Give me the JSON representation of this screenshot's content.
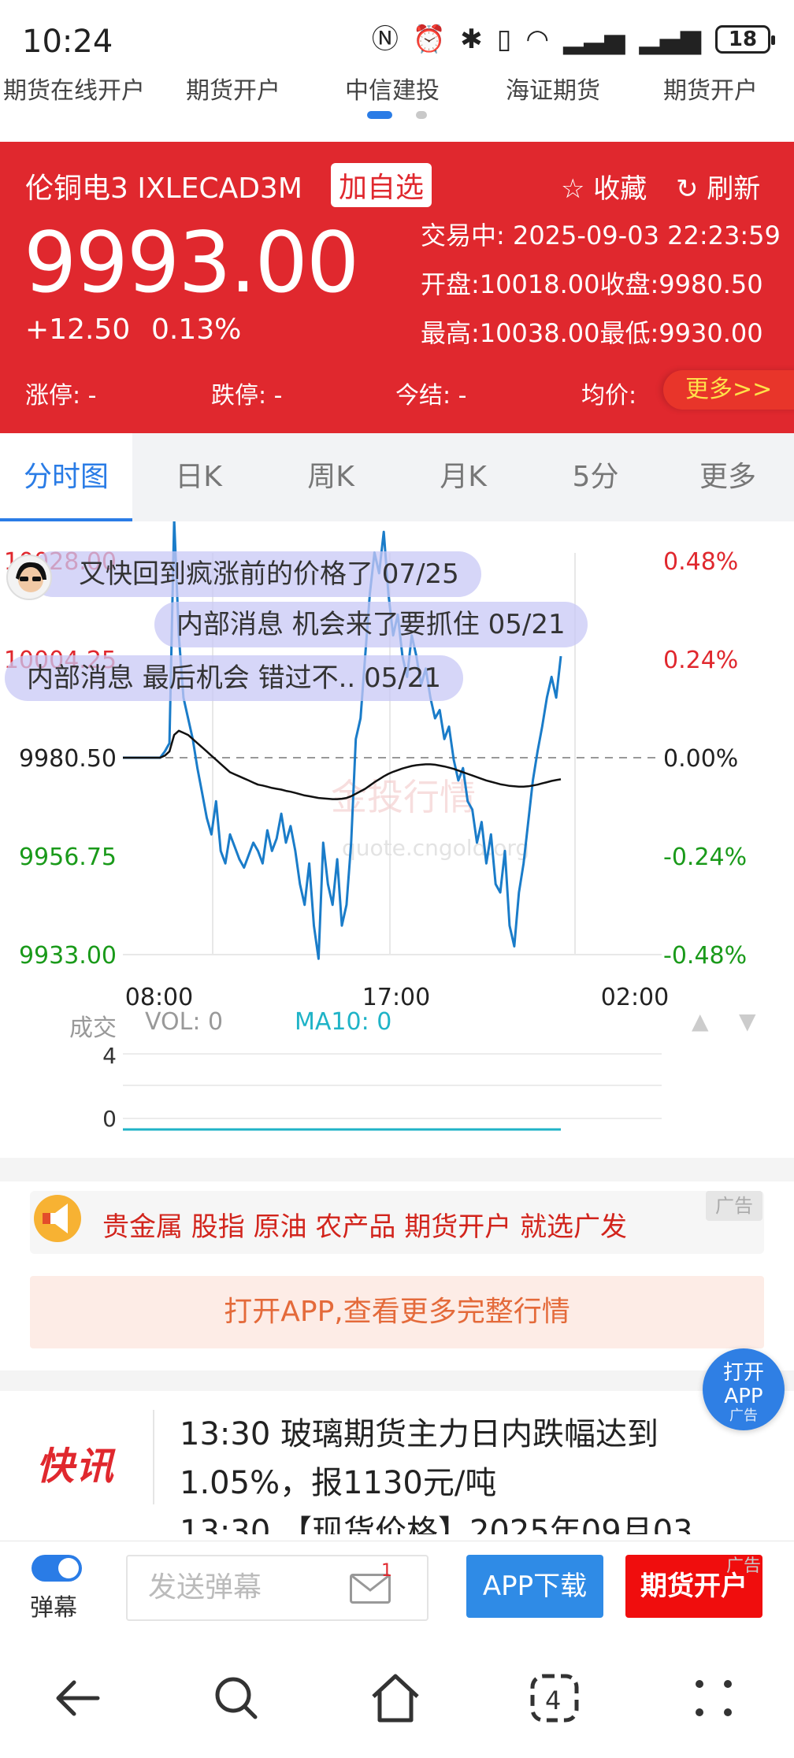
{
  "status": {
    "time": "10:24",
    "battery": "18"
  },
  "ad_tabs": [
    "期货在线开户",
    "期货开户",
    "中信建投",
    "海证期货",
    "期货开户"
  ],
  "quote": {
    "name": "伦铜电3 IXLECAD3M",
    "add_fav": "加自选",
    "collect": "收藏",
    "refresh": "刷新",
    "price": "9993.00",
    "change": "+12.50",
    "change_pct": "0.13%",
    "trading_time": "交易中: 2025-09-03 22:23:59",
    "open_close": "开盘:10018.00收盘:9980.50",
    "high_low": "最高:10038.00最低:9930.00",
    "limit_up": "涨停: -",
    "limit_down": "跌停: -",
    "settle": "今结: -",
    "avg": "均价:",
    "more": "更多>>"
  },
  "tabs": [
    "分时图",
    "日K",
    "周K",
    "月K",
    "5分",
    "更多"
  ],
  "chart_data": {
    "type": "line",
    "xlabel": "",
    "ylabel": "",
    "x_ticks": [
      "08:00",
      "17:00",
      "02:00"
    ],
    "y_ticks_left": [
      "10028.00",
      "10004.25",
      "9980.50",
      "9956.75",
      "9933.00"
    ],
    "y_ticks_right": [
      "0.48%",
      "0.24%",
      "0.00%",
      "-0.24%",
      "-0.48%"
    ],
    "ylim": [
      9933.0,
      10028.0
    ],
    "reference": 9980.5,
    "series": [
      {
        "color": "#1a7cc9",
        "values": [
          9980.5,
          9980.5,
          9980.5,
          9980.5,
          9980.5,
          9980.5,
          9980.5,
          9980.5,
          9980.5,
          9982,
          9984,
          10038,
          10010,
          9995,
          9990,
          9985,
          9978,
          9972,
          9966,
          9962,
          9970,
          9958,
          9955,
          9962,
          9959,
          9956,
          9954,
          9957,
          9960,
          9958,
          9955,
          9963,
          9958,
          9961,
          9967,
          9960,
          9964,
          9958,
          9950,
          9945,
          9955,
          9940,
          9932,
          9960,
          9950,
          9945,
          9956,
          9940,
          9945,
          9960,
          9985,
          9990,
          10005,
          10020,
          10030,
          10025,
          10035,
          10020,
          10010,
          10015,
          10005,
          10000,
          10010,
          10005,
          9998,
          10002,
          9995,
          9990,
          9992,
          9985,
          9988,
          9980,
          9975,
          9978,
          9970,
          9968,
          9960,
          9965,
          9955,
          9962,
          9950,
          9948,
          9958,
          9940,
          9935,
          9948,
          9955,
          9965,
          9975,
          9982,
          9988,
          9995,
          10000,
          9995,
          10005
        ],
        "name": ""
      },
      {
        "color": "#111111",
        "values": [
          9980.5,
          9980.5,
          9980.5,
          9980.5,
          9980.5,
          9980.5,
          9980.5,
          9980.5,
          9980.5,
          9981,
          9982,
          9986,
          9987,
          9986.5,
          9986,
          9985,
          9984,
          9983,
          9982,
          9981,
          9980,
          9979,
          9978,
          9977,
          9976.5,
          9976,
          9975.5,
          9975,
          9974.5,
          9974,
          9973.8,
          9973.5,
          9973.2,
          9973,
          9972.8,
          9972.5,
          9972.3,
          9972,
          9971.7,
          9971.4,
          9971.2,
          9971,
          9970.8,
          9970.7,
          9970.6,
          9970.5,
          9970.5,
          9970.6,
          9970.8,
          9971.2,
          9971.8,
          9972.4,
          9973,
          9973.8,
          9974.6,
          9975.3,
          9976,
          9976.6,
          9977.1,
          9977.5,
          9977.9,
          9978.2,
          9978.5,
          9978.7,
          9978.8,
          9978.9,
          9978.9,
          9978.8,
          9978.6,
          9978.4,
          9978.1,
          9977.8,
          9977.4,
          9977,
          9976.6,
          9976.2,
          9975.8,
          9975.4,
          9975,
          9974.7,
          9974.4,
          9974.1,
          9973.9,
          9973.7,
          9973.6,
          9973.5,
          9973.5,
          9973.6,
          9973.8,
          9974,
          9974.3,
          9974.6,
          9974.9,
          9975.1,
          9975.3
        ],
        "name": ""
      }
    ]
  },
  "watermark": {
    "title": "金投行情",
    "url": "quote.cngold.org"
  },
  "danmu": [
    {
      "text": "又快回到疯涨前的价格了 07/25",
      "has_avatar": true
    },
    {
      "text": "内部消息 机会来了要抓住 05/21"
    },
    {
      "text": "内部消息 最后机会 错过不.. 05/21"
    }
  ],
  "volume": {
    "label": "成交",
    "vol": "VOL: 0",
    "ma10": "MA10: 0",
    "ticks": [
      "4",
      "0"
    ]
  },
  "ad": {
    "text": "贵金属 股指 原油 农产品 期货开户 就选广发",
    "tag": "广告",
    "open_app": "打开APP,查看更多完整行情"
  },
  "float_app": {
    "line1": "打开",
    "line2": "APP",
    "tag": "广告"
  },
  "news": {
    "logo": "快讯",
    "text": "13:30 玻璃期货主力日内跌幅达到1.05%，报1130元/吨\n13:30 【现货价格】2025年09月03"
  },
  "bottom": {
    "toggle_label": "弹幕",
    "input_placeholder": "发送弹幕",
    "mail_badge": "1",
    "app_download": "APP下载",
    "futures_open": "期货开户",
    "futures_tag": "广告"
  },
  "colors": {
    "red": "#e0282e",
    "blue": "#2a7ce6",
    "green": "#1a9a1a",
    "chart_line": "#1a7cc9"
  }
}
